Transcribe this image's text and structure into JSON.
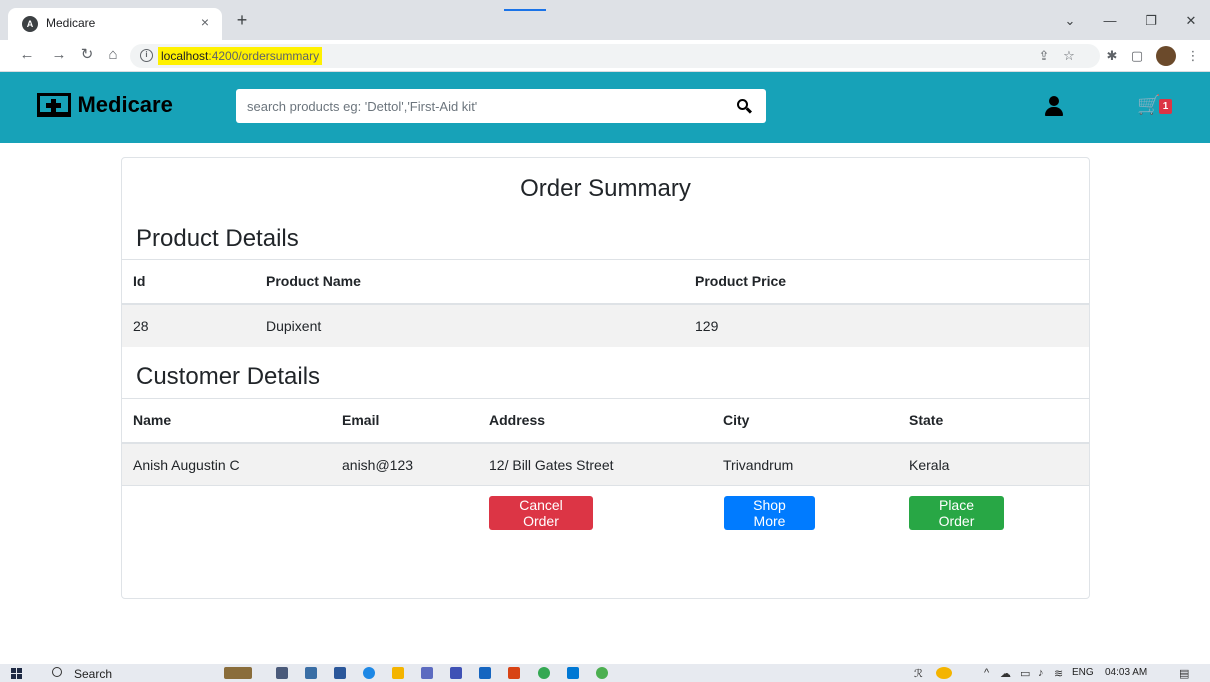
{
  "browser": {
    "tab_title": "Medicare",
    "tab_close": "×",
    "new_tab": "+",
    "url_host": "localhost",
    "url_path": ":4200/ordersummary",
    "controls": {
      "dropdown": "⌄",
      "minimize": "—",
      "restore": "❐",
      "close": "✕"
    }
  },
  "navbar": {
    "brand": "Medicare",
    "search_placeholder": "search products eg: 'Dettol','First-Aid kit'",
    "cart_count": "1"
  },
  "summary": {
    "title": "Order Summary",
    "product_section": "Product Details",
    "product_headers": {
      "id": "Id",
      "name": "Product Name",
      "price": "Product Price"
    },
    "product": {
      "id": "28",
      "name": "Dupixent",
      "price": "129"
    },
    "customer_section": "Customer Details",
    "customer_headers": {
      "name": "Name",
      "email": "Email",
      "address": "Address",
      "city": "City",
      "state": "State"
    },
    "customer": {
      "name": "Anish Augustin C",
      "email": "anish@123",
      "address": "12/ Bill Gates Street",
      "city": "Trivandrum",
      "state": "Kerala"
    },
    "buttons": {
      "cancel": "Cancel Order",
      "shop_more": "Shop More",
      "place": "Place Order"
    }
  },
  "taskbar": {
    "search_label": "Search",
    "language": "ENG",
    "time": "04:03 AM"
  },
  "colors": {
    "navbar": "#17a2b8",
    "danger": "#dc3545",
    "primary": "#007bff",
    "success": "#28a745",
    "url_highlight": "#fff100"
  }
}
